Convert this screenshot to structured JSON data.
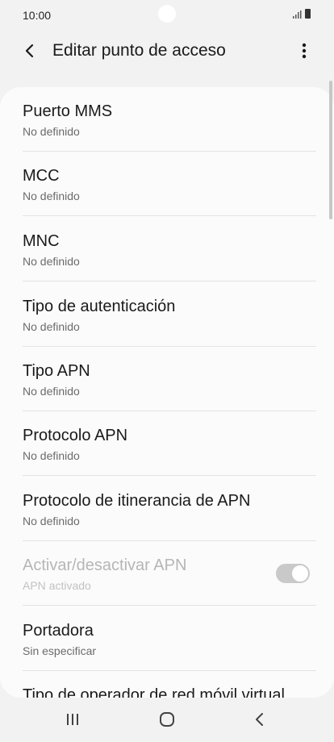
{
  "status_bar": {
    "time": "10:00"
  },
  "header": {
    "title": "Editar punto de acceso"
  },
  "settings": [
    {
      "title": "Puerto MMS",
      "subtitle": "No definido"
    },
    {
      "title": "MCC",
      "subtitle": "No definido"
    },
    {
      "title": "MNC",
      "subtitle": "No definido"
    },
    {
      "title": "Tipo de autenticación",
      "subtitle": "No definido"
    },
    {
      "title": "Tipo APN",
      "subtitle": "No definido"
    },
    {
      "title": "Protocolo APN",
      "subtitle": "No definido"
    },
    {
      "title": "Protocolo de itinerancia de APN",
      "subtitle": "No definido"
    },
    {
      "title": "Activar/desactivar APN",
      "subtitle": "APN activado",
      "toggle_on": true,
      "disabled": true
    },
    {
      "title": "Portadora",
      "subtitle": "Sin especificar"
    },
    {
      "title": "Tipo de operador de red móvil virtual"
    }
  ],
  "nav": {
    "items": [
      "recent-apps-icon",
      "home-icon",
      "back-icon"
    ]
  }
}
